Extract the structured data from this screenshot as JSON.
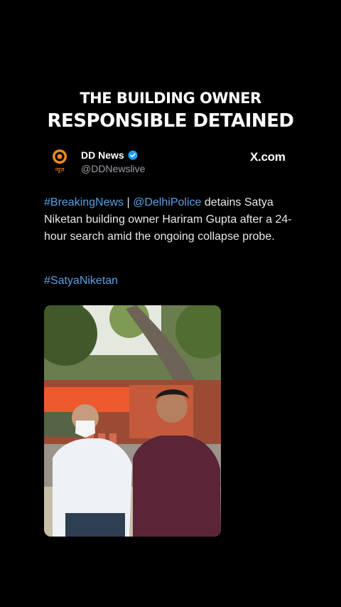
{
  "headline": {
    "line1": "THE BUILDING OWNER",
    "line2": "RESPONSIBLE DETAINED"
  },
  "account": {
    "name": "DD News",
    "handle": "@DDNewslive",
    "logo_text": "न्यूज़",
    "verified_icon": "verified-badge-icon"
  },
  "source": "X.com",
  "tweet": {
    "hashtag1": "#BreakingNews",
    "separator": " | ",
    "mention": "@DelhiPolice",
    "body": " detains Satya Niketan building owner Hariram Gupta after a 24-hour search amid the ongoing collapse probe.",
    "hashtag2": "#SatyaNiketan"
  },
  "colors": {
    "background": "#000000",
    "link": "#5aa0e6",
    "logo": "#f08a1c",
    "verified": "#1d9bf0"
  }
}
